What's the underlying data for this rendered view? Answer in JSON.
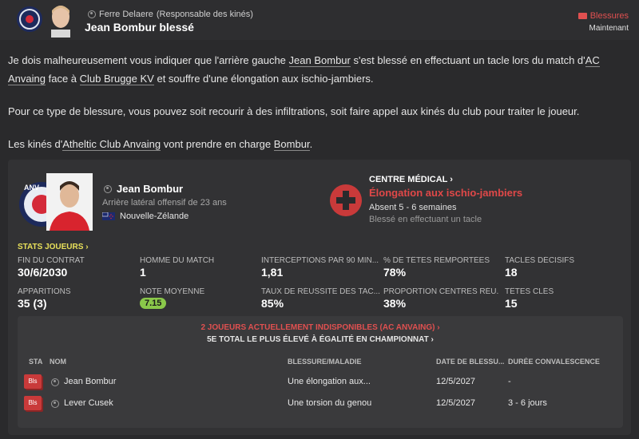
{
  "header": {
    "sender_name": "Ferre Delaere",
    "sender_role": "(Responsable des kinés)",
    "subject": "Jean Bombur blessé",
    "tag": "Blessures",
    "time": "Maintenant"
  },
  "message": {
    "p1_pre": "Je dois malheureusement vous indiquer que l'arrière gauche ",
    "p1_player": "Jean Bombur",
    "p1_mid": " s'est blessé en effectuant un tacle lors du match d'",
    "p1_home": "AC Anvaing",
    "p1_vs": " face à ",
    "p1_away": "Club Brugge KV",
    "p1_post": " et souffre d'une élongation aux ischio-jambiers.",
    "p2": "Pour ce type de blessure, vous pouvez soit recourir à des infiltrations, soit faire appel aux kinés du club pour traiter le joueur.",
    "p3_pre": "Les kinés d'",
    "p3_club": "Atheltic Club Anvaing",
    "p3_mid": " vont prendre en charge ",
    "p3_player": "Bombur",
    "p3_post": "."
  },
  "player": {
    "name": "Jean Bombur",
    "role": "Arrière latéral offensif de 23 ans",
    "nation": "Nouvelle-Zélande",
    "badge_text": "ANV"
  },
  "medical": {
    "title": "CENTRE MÉDICAL",
    "injury": "Élongation aux ischio-jambiers",
    "absent": "Absent 5 - 6 semaines",
    "cause": "Blessé en effectuant un tacle"
  },
  "stats": {
    "title": "STATS JOUEURS",
    "contract_label": "FIN DU CONTRAT",
    "contract_value": "30/6/2030",
    "motm_label": "HOMME DU MATCH",
    "motm_value": "1",
    "interceptions_label": "INTERCEPTIONS PAR 90 MIN...",
    "interceptions_value": "1,81",
    "headers_label": "% DE TÊTES REMPORTÉES",
    "headers_value": "78%",
    "tackles_label": "TACLES DÉCISIFS",
    "tackles_value": "18",
    "apps_label": "APPARITIONS",
    "apps_value": "35 (3)",
    "rating_label": "NOTE MOYENNE",
    "rating_value": "7.15",
    "tackle_rate_label": "TAUX DE RÉUSSITE DES TAC...",
    "tackle_rate_value": "85%",
    "crosses_label": "PROPORTION CENTRES RÉU...",
    "crosses_value": "38%",
    "key_headers_label": "TÊTES CLÉS",
    "key_headers_value": "15"
  },
  "unavailable": {
    "title": "2 JOUEURS ACTUELLEMENT INDISPONIBLES (AC ANVAING)",
    "subtitle": "5E TOTAL LE PLUS ÉLEVÉ À ÉGALITÉ EN CHAMPIONNAT",
    "columns": [
      "STA",
      "NOM",
      "BLESSURE/MALADIE",
      "DATE DE BLESSU...",
      "DURÉE CONVALESCENCE"
    ],
    "rows": [
      {
        "status": "Bls",
        "name": "Jean Bombur",
        "injury": "Une élongation aux...",
        "date": "12/5/2027",
        "duration": "-"
      },
      {
        "status": "Bls",
        "name": "Lever Cusek",
        "injury": "Une torsion du genou",
        "date": "12/5/2027",
        "duration": "3 - 6 jours"
      }
    ]
  },
  "colors": {
    "accent_red": "#e05050",
    "stats_yellow": "#e8e05a",
    "rating_green": "#8ac84a"
  }
}
